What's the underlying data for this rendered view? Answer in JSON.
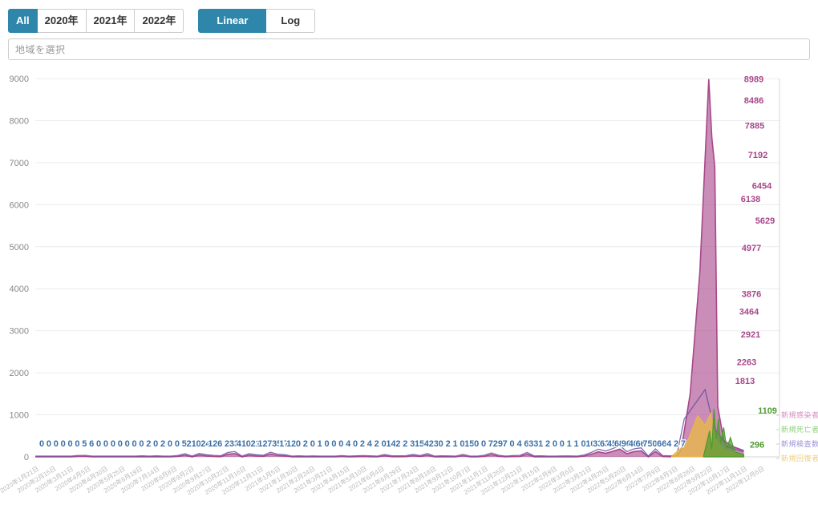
{
  "toolbar": {
    "range_buttons": [
      {
        "label": "All",
        "active": true
      },
      {
        "label": "2020年",
        "active": false
      },
      {
        "label": "2021年",
        "active": false
      },
      {
        "label": "2022年",
        "active": false
      }
    ],
    "scale_buttons": [
      {
        "label": "Linear",
        "active": true
      },
      {
        "label": "Log",
        "active": false
      }
    ]
  },
  "search": {
    "value": "",
    "placeholder": "地域を選択"
  },
  "chart_data": {
    "type": "line",
    "title": "",
    "xlabel": "",
    "ylabel": "",
    "ylim": [
      0,
      9000
    ],
    "yticks": [
      0,
      1000,
      2000,
      3000,
      4000,
      5000,
      6000,
      7000,
      8000,
      9000
    ],
    "grid": true,
    "legend_position": "right-bottom",
    "colors": {
      "series1": "#a8478a",
      "series2": "#4e9a2f",
      "series3": "#6a4fa3",
      "series4": "#e8b84b",
      "label_blue": "#3a6ea5"
    },
    "xtick_labels": [
      "2020年1月21日",
      "2020年2月15日",
      "2020年3月11日",
      "2020年4月5日",
      "2020年4月30日",
      "2020年5月25日",
      "2020年6月19日",
      "2020年7月14日",
      "2020年8月8日",
      "2020年9月2日",
      "2020年9月27日",
      "2020年10月22日",
      "2020年11月16日",
      "2020年12月11日",
      "2021年1月5日",
      "2021年1月30日",
      "2021年2月24日",
      "2021年3月21日",
      "2021年4月15日",
      "2021年5月10日",
      "2021年6月4日",
      "2021年6月29日",
      "2021年7月24日",
      "2021年8月18日",
      "2021年9月12日",
      "2021年10月7日",
      "2021年11月1日",
      "2021年11月26日",
      "2021年12月21日",
      "2022年1月15日",
      "2022年2月9日",
      "2022年3月6日",
      "2022年3月31日",
      "2022年4月25日",
      "2022年5月20日",
      "2022年6月14日",
      "2022年7月9日",
      "2022年8月3日",
      "2022年8月28日",
      "2022年9月22日",
      "2022年10月17日",
      "2022年11月11日",
      "2022年12月6日"
    ],
    "series": [
      {
        "name": "新規感染者数",
        "color": "#a8478a",
        "peak_labels": [
          8989,
          8486,
          7885,
          7192,
          6454,
          6138,
          5629,
          4977,
          3876,
          3464,
          2921,
          2263,
          1813
        ]
      },
      {
        "name": "新規死亡者",
        "color": "#4e9a2f",
        "peak_labels": [
          1109,
          296
        ]
      },
      {
        "name": "新規検査数",
        "color": "#6a4fa3",
        "peak_labels": []
      },
      {
        "name": "新規回復者数",
        "color": "#e8b84b",
        "peak_labels": []
      }
    ],
    "inline_labels": [
      0,
      0,
      0,
      0,
      0,
      0,
      5,
      6,
      0,
      0,
      0,
      0,
      0,
      0,
      0,
      2,
      0,
      2,
      0,
      0,
      5,
      21,
      0,
      24,
      12,
      6,
      2,
      33,
      41,
      0,
      21,
      12,
      7,
      35,
      17,
      12,
      0,
      2,
      0,
      1,
      0,
      0,
      0,
      4,
      0,
      2,
      4,
      2,
      0,
      14,
      2,
      2,
      3,
      15,
      4,
      23,
      0,
      2,
      1,
      0,
      15,
      0,
      0,
      7,
      29,
      7,
      0,
      4,
      6,
      33,
      1,
      2,
      0,
      0,
      1,
      1,
      0,
      10,
      33,
      63,
      45,
      68,
      96,
      40,
      66,
      75,
      0,
      66,
      4,
      2,
      7
    ]
  },
  "legend": {
    "items": [
      {
        "label": "新規感染者数",
        "color": "#d48ec0"
      },
      {
        "label": "新規死亡者",
        "color": "#8fd07a"
      },
      {
        "label": "新規検査数",
        "color": "#9d92d6"
      },
      {
        "label": "新規回復者数",
        "color": "#f0ce7a"
      }
    ]
  }
}
